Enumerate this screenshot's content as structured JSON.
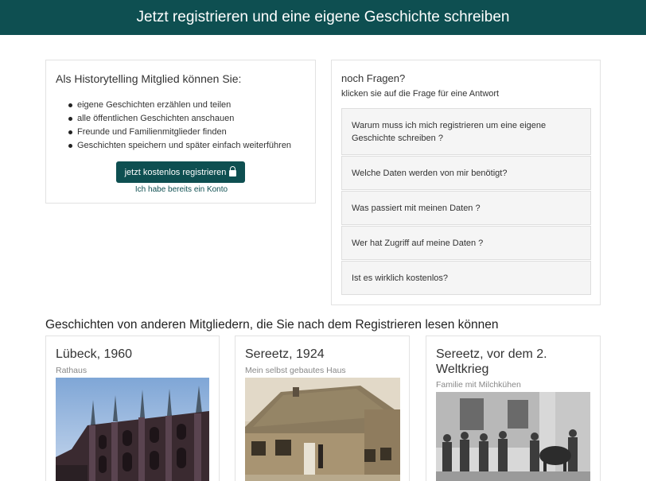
{
  "header": {
    "title": "Jetzt registrieren und eine eigene Geschichte schreiben"
  },
  "benefits": {
    "title": "Als Historytelling Mitglied können Sie:",
    "items": [
      "eigene Geschichten erzählen und teilen",
      "alle öffentlichen Geschichten anschauen",
      "Freunde und Familienmitglieder finden",
      "Geschichten speichern und später einfach weiterführen"
    ],
    "register_button": "jetzt kostenlos registrieren",
    "login_link": "Ich habe bereits ein Konto"
  },
  "faq": {
    "title": "noch Fragen?",
    "subtitle": "klicken sie auf die Frage für eine Antwort",
    "items": [
      "Warum muss ich mich registrieren um eine eigene Geschichte schreiben ?",
      "Welche Daten werden von mir benötigt?",
      "Was passiert mit meinen Daten ?",
      "Wer hat Zugriff auf meine Daten ?",
      "Ist es wirklich kostenlos?"
    ]
  },
  "stories": {
    "heading": "Geschichten von anderen Mitgliedern, die Sie nach dem Registrieren lesen können",
    "cards": [
      {
        "title": "Lübeck, 1960",
        "subtitle": "Rathaus"
      },
      {
        "title": "Sereetz, 1924",
        "subtitle": "Mein selbst gebautes Haus"
      },
      {
        "title": "Sereetz, vor dem 2. Weltkrieg",
        "subtitle": "Familie mit Milchkühen"
      }
    ]
  },
  "colors": {
    "brand": "#0e4f51",
    "faq_bg": "#f5f5f5",
    "muted": "#888888"
  }
}
